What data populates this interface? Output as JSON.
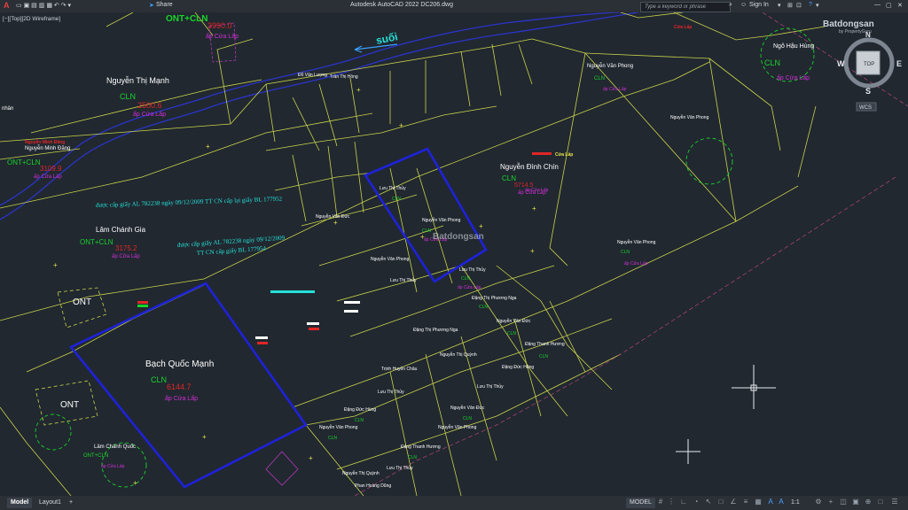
{
  "app": {
    "logo": "A",
    "share_label": "Share",
    "title": "Autodesk AutoCAD 2022   DC206.dwg",
    "search_placeholder": "Type a keyword or phrase",
    "signin_label": "Sign In",
    "help": "?",
    "viewport_label": "[−][Top][2D Wireframe]"
  },
  "viewcube": {
    "top": "TOP",
    "n": "N",
    "s": "S",
    "e": "E",
    "w": "W",
    "wcs": "WCS"
  },
  "watermark": {
    "brand": "Batdongsan",
    "sub": "by PropertyGuru"
  },
  "status": {
    "tabs": [
      "Model",
      "Layout1"
    ],
    "add": "+",
    "model_label": "MODEL",
    "scale": "1:1"
  },
  "drawing": {
    "river_label": "suối",
    "owners": {
      "thi_manh": "Nguyễn Thị Mạnh",
      "cln": "CLN",
      "area_1": "2500.6",
      "hamlet": "ấp Cửa Lấp",
      "ont_cln": "ONT+CLN",
      "area_2": "3990.0",
      "chanh_gia": "Lâm Chánh Gia",
      "area_3": "3175.2",
      "minh_dang": "Nguyễn Minh Đăng",
      "area_4": "3109.9",
      "quoc_manh": "Bạch Quốc Mạnh",
      "area_5": "6144.7",
      "dinh_chin": "Nguyễn Đình Chín",
      "area_6": "5714.5",
      "van_phong": "Nguyễn Văn Phong",
      "hau_hung": "Ngô Hậu Hùng",
      "ont": "ONT",
      "chanh_quoc": "Lâm Chánh Quốc",
      "cert_1": "được cấp giấy AL 782238 ngày 09/12/2009 TT CN cấp lại giấy BL 177952",
      "cert_2": "được cấp giấy AL 782238 ngày 09/12/2009",
      "cert_3": "TT CN cấp giấy BL 177954",
      "luu_thi_thuy": "Lưu Thị Thủy",
      "dang_thi_phuong_nga": "Đặng Thị Phương Nga",
      "nguyen_van_duc": "Nguyễn Văn Đức",
      "dang_duc_hung": "Đặng Đức Hùng",
      "dang_thanh_huong": "Đặng Thanh Hương",
      "phan_hoang_dung": "Phan Hoàng Dũng",
      "nguyen_thi_quynh": "Nguyễn Thị Quỳnh",
      "trinh_huyen_chan": "Trịnh Huyền Châu",
      "do_van_luong": "Đỗ Văn Lượng",
      "tran_thi_hong": "Trần Thị Hồng",
      "nhan": "nhân"
    }
  },
  "colors": {
    "background": "#212830",
    "parcel_line": "#c9d34a",
    "highlight": "#1e22d8",
    "river": "#2b34c9",
    "owner_text": "#ffffff",
    "cln_text": "#19d42b",
    "hamlet_text": "#d22fd6",
    "area_text": "#e02626",
    "cert_text": "#25e0d8",
    "ont_text": "#ffffff"
  }
}
